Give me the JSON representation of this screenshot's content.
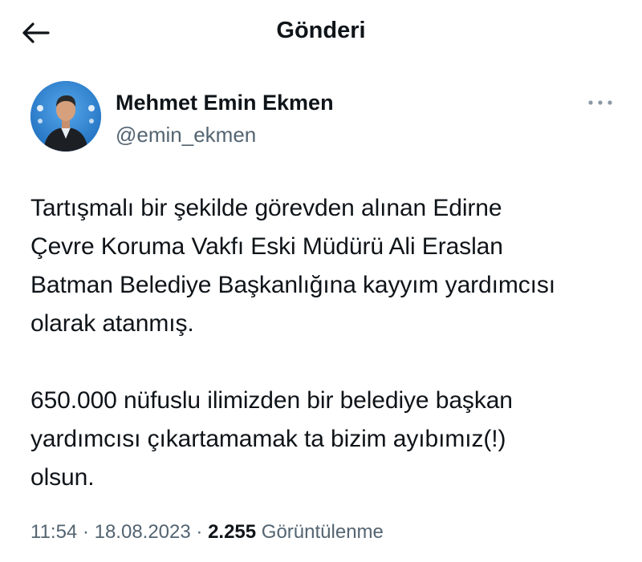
{
  "header": {
    "title": "Gönderi"
  },
  "author": {
    "name": "Mehmet Emin Ekmen",
    "handle": "@emin_ekmen"
  },
  "tweet": {
    "paragraph1_lines": [
      "Tartışmalı bir şekilde görevden alınan Edirne",
      "Çevre Koruma Vakfı Eski Müdürü Ali Eraslan",
      "Batman Belediye Başkanlığına kayyım yardımcısı",
      "olarak atanmış."
    ],
    "paragraph2_lines": [
      "650.000 nüfuslu ilimizden bir belediye başkan",
      "yardımcısı çıkartamamak ta bizim ayıbımız(!)",
      "olsun."
    ]
  },
  "meta": {
    "time": "11:54",
    "sep1": " · ",
    "date": "18.08.2023",
    "sep2": " · ",
    "views_count": "2.255",
    "views_label": " Görüntülenme"
  },
  "colors": {
    "text_primary": "#0f1419",
    "text_secondary": "#536471",
    "avatar_bg": "#2f86d6"
  },
  "icons": {
    "back": "arrow-left-icon",
    "more": "more-dots-icon"
  }
}
